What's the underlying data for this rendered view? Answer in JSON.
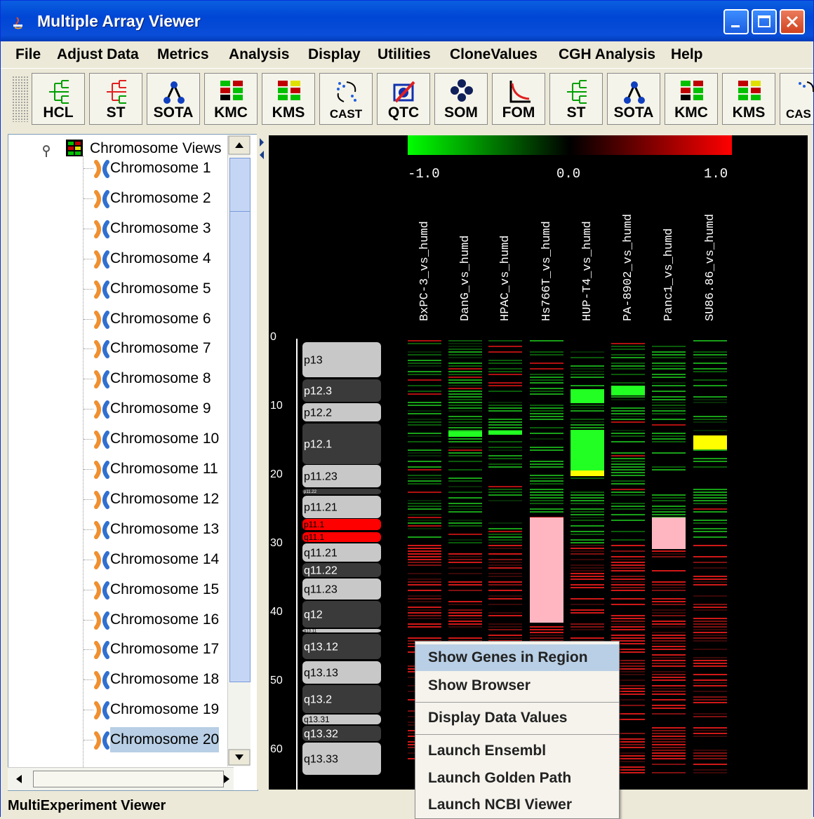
{
  "window": {
    "title": "Multiple Array Viewer"
  },
  "menu": [
    "File",
    "Adjust Data",
    "Metrics",
    "Analysis",
    "Display",
    "Utilities",
    "CloneValues",
    "CGH Analysis",
    "Help"
  ],
  "toolbar": [
    "HCL",
    "ST",
    "SOTA",
    "KMC",
    "KMS",
    "CAST",
    "QTC",
    "SOM",
    "FOM",
    "ST",
    "SOTA",
    "KMC",
    "KMS",
    "CAS"
  ],
  "tree": {
    "root": "Chromosome Views",
    "items": [
      "Chromosome 1",
      "Chromosome 2",
      "Chromosome 3",
      "Chromosome 4",
      "Chromosome 5",
      "Chromosome 6",
      "Chromosome 7",
      "Chromosome 8",
      "Chromosome 9",
      "Chromosome 10",
      "Chromosome 11",
      "Chromosome 12",
      "Chromosome 13",
      "Chromosome 14",
      "Chromosome 15",
      "Chromosome 16",
      "Chromosome 17",
      "Chromosome 18",
      "Chromosome 19",
      "Chromosome 20"
    ],
    "selected": "Chromosome 20"
  },
  "scale": {
    "min": "-1.0",
    "mid": "0.0",
    "max": "1.0",
    "colors": [
      "#00ff00",
      "#000000",
      "#ff0000"
    ]
  },
  "experiments": [
    "BxPC-3_vs_humd",
    "DanG_vs_humd",
    "HPAC_vs_humd",
    "Hs766T_vs_humd",
    "HUP-T4_vs_humd",
    "PA-8902_vs_humd",
    "Panc1_vs_humd",
    "SU86.86_vs_humd"
  ],
  "positions": [
    "0",
    "10",
    "20",
    "30",
    "40",
    "50",
    "60"
  ],
  "bands": [
    "p13",
    "p12.3",
    "p12.2",
    "p12.1",
    "p11.23",
    "p11.22",
    "p11.21",
    "p11.1",
    "q11.1",
    "q11.21",
    "q11.22",
    "q11.23",
    "q12",
    "q13.11",
    "q13.12",
    "q13.13",
    "q13.2",
    "q13.31",
    "q13.32",
    "q13.33"
  ],
  "context_menu": [
    "Show Genes in Region",
    "Show Browser",
    "Display Data Values",
    "Launch Ensembl",
    "Launch Golden Path",
    "Launch NCBI Viewer"
  ],
  "status": "MultiExperiment Viewer"
}
